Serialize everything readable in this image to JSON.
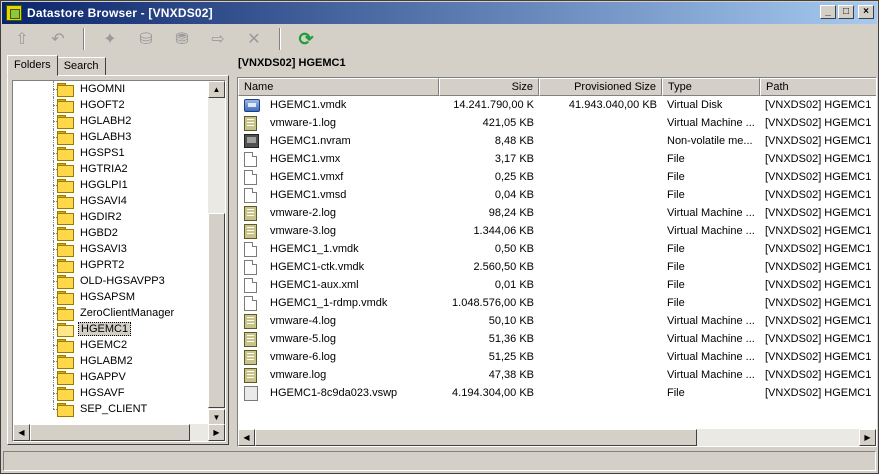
{
  "window": {
    "title": "Datastore Browser - [VNXDS02]",
    "min_glyph": "_",
    "max_glyph": "□",
    "close_glyph": "×"
  },
  "toolbar": {
    "tools": [
      {
        "icon": "up-folder-icon",
        "glyph": "⇧"
      },
      {
        "icon": "back-folder-icon",
        "glyph": "↶"
      },
      {
        "icon": "new-folder-icon",
        "glyph": "✦"
      },
      {
        "icon": "upload-icon",
        "glyph": "⛁"
      },
      {
        "icon": "download-icon",
        "glyph": "⛃"
      },
      {
        "icon": "move-icon",
        "glyph": "⇨"
      },
      {
        "icon": "delete-icon",
        "glyph": "✕"
      },
      {
        "icon": "refresh-icon",
        "glyph": "⟳"
      }
    ]
  },
  "tabs": {
    "folders": "Folders",
    "search": "Search"
  },
  "tree": {
    "items": [
      {
        "label": "HGOMNI"
      },
      {
        "label": "HGOFT2"
      },
      {
        "label": "HGLABH2"
      },
      {
        "label": "HGLABH3"
      },
      {
        "label": "HGSPS1"
      },
      {
        "label": "HGTRIA2"
      },
      {
        "label": "HGGLPI1"
      },
      {
        "label": "HGSAVI4"
      },
      {
        "label": "HGDIR2"
      },
      {
        "label": "HGBD2"
      },
      {
        "label": "HGSAVI3"
      },
      {
        "label": "HGPRT2"
      },
      {
        "label": "OLD-HGSAVPP3"
      },
      {
        "label": "HGSAPSM"
      },
      {
        "label": "ZeroClientManager"
      },
      {
        "label": "HGEMC1",
        "selected": true
      },
      {
        "label": "HGEMC2"
      },
      {
        "label": "HGLABM2"
      },
      {
        "label": "HGAPPV"
      },
      {
        "label": "HGSAVF"
      },
      {
        "label": "SEP_CLIENT"
      }
    ]
  },
  "main": {
    "path": "[VNXDS02] HGEMC1",
    "columns": [
      "Name",
      "Size",
      "Provisioned Size",
      "Type",
      "Path"
    ],
    "files": [
      {
        "icon": "disk",
        "name": "HGEMC1.vmdk",
        "size": "14.241.790,00 K",
        "provisioned": "41.943.040,00 KB",
        "type": "Virtual Disk",
        "path": "[VNXDS02] HGEMC1"
      },
      {
        "icon": "log",
        "name": "vmware-1.log",
        "size": "421,05 KB",
        "provisioned": "",
        "type": "Virtual Machine ...",
        "path": "[VNXDS02] HGEMC1"
      },
      {
        "icon": "nvram",
        "name": "HGEMC1.nvram",
        "size": "8,48 KB",
        "provisioned": "",
        "type": "Non-volatile me...",
        "path": "[VNXDS02] HGEMC1"
      },
      {
        "icon": "file",
        "name": "HGEMC1.vmx",
        "size": "3,17 KB",
        "provisioned": "",
        "type": "File",
        "path": "[VNXDS02] HGEMC1"
      },
      {
        "icon": "file",
        "name": "HGEMC1.vmxf",
        "size": "0,25 KB",
        "provisioned": "",
        "type": "File",
        "path": "[VNXDS02] HGEMC1"
      },
      {
        "icon": "file",
        "name": "HGEMC1.vmsd",
        "size": "0,04 KB",
        "provisioned": "",
        "type": "File",
        "path": "[VNXDS02] HGEMC1"
      },
      {
        "icon": "log",
        "name": "vmware-2.log",
        "size": "98,24 KB",
        "provisioned": "",
        "type": "Virtual Machine ...",
        "path": "[VNXDS02] HGEMC1"
      },
      {
        "icon": "log",
        "name": "vmware-3.log",
        "size": "1.344,06 KB",
        "provisioned": "",
        "type": "Virtual Machine ...",
        "path": "[VNXDS02] HGEMC1"
      },
      {
        "icon": "file",
        "name": "HGEMC1_1.vmdk",
        "size": "0,50 KB",
        "provisioned": "",
        "type": "File",
        "path": "[VNXDS02] HGEMC1"
      },
      {
        "icon": "file",
        "name": "HGEMC1-ctk.vmdk",
        "size": "2.560,50 KB",
        "provisioned": "",
        "type": "File",
        "path": "[VNXDS02] HGEMC1"
      },
      {
        "icon": "file",
        "name": "HGEMC1-aux.xml",
        "size": "0,01 KB",
        "provisioned": "",
        "type": "File",
        "path": "[VNXDS02] HGEMC1"
      },
      {
        "icon": "file",
        "name": "HGEMC1_1-rdmp.vmdk",
        "size": "1.048.576,00 KB",
        "provisioned": "",
        "type": "File",
        "path": "[VNXDS02] HGEMC1"
      },
      {
        "icon": "log",
        "name": "vmware-4.log",
        "size": "50,10 KB",
        "provisioned": "",
        "type": "Virtual Machine ...",
        "path": "[VNXDS02] HGEMC1"
      },
      {
        "icon": "log",
        "name": "vmware-5.log",
        "size": "51,36 KB",
        "provisioned": "",
        "type": "Virtual Machine ...",
        "path": "[VNXDS02] HGEMC1"
      },
      {
        "icon": "log",
        "name": "vmware-6.log",
        "size": "51,25 KB",
        "provisioned": "",
        "type": "Virtual Machine ...",
        "path": "[VNXDS02] HGEMC1"
      },
      {
        "icon": "log",
        "name": "vmware.log",
        "size": "47,38 KB",
        "provisioned": "",
        "type": "Virtual Machine ...",
        "path": "[VNXDS02] HGEMC1"
      },
      {
        "icon": "swap",
        "name": "HGEMC1-8c9da023.vswp",
        "size": "4.194.304,00 KB",
        "provisioned": "",
        "type": "File",
        "path": "[VNXDS02] HGEMC1"
      }
    ]
  },
  "scrollbar": {
    "up": "▲",
    "down": "▼",
    "left": "◀",
    "right": "▶"
  }
}
